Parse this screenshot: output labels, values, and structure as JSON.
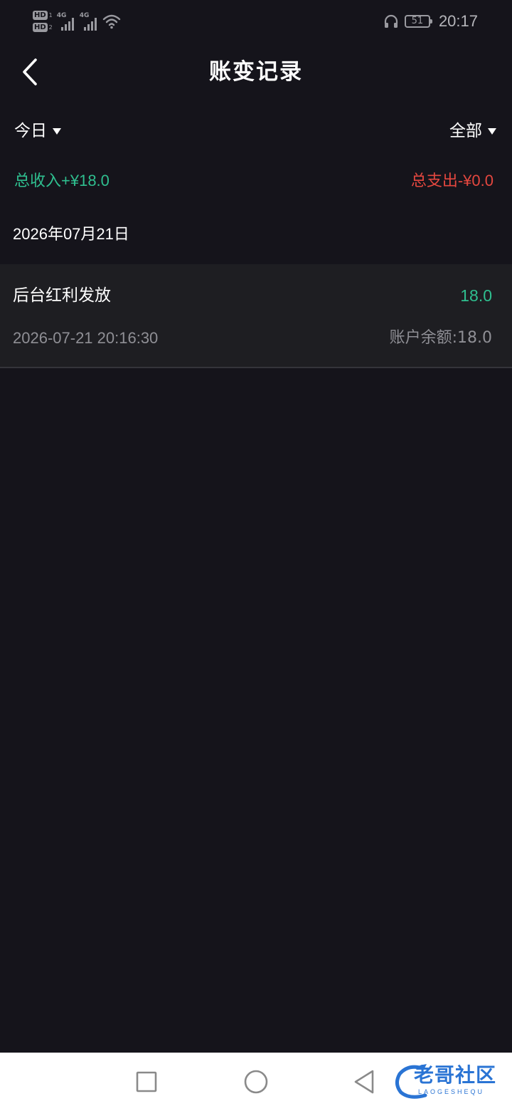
{
  "status_bar": {
    "sim1_hd": "HD",
    "sim1_index": "1",
    "sim2_hd": "HD",
    "sim2_index": "2",
    "network_1": "4G",
    "network_2": "4G",
    "battery_level": "51",
    "time": "20:17",
    "icons": [
      "signal-icon",
      "wifi-icon",
      "headphones-icon",
      "battery-icon"
    ]
  },
  "header": {
    "title": "账变记录",
    "back_icon": "chevron-left-icon"
  },
  "filters": {
    "date_range": "今日",
    "type": "全部"
  },
  "summary": {
    "income": "总收入+¥18.0",
    "expense": "总支出-¥0.0",
    "income_color": "#2fbf8f",
    "expense_color": "#e4473f"
  },
  "groups": [
    {
      "date": "2026年07月21日",
      "records": [
        {
          "title": "后台红利发放",
          "amount": "18.0",
          "time": "2026-07-21 20:16:30",
          "balance": "账户余额:18.0"
        }
      ]
    }
  ],
  "nav_bar": {
    "icons": [
      "recent-apps-icon",
      "home-icon",
      "back-triangle-icon"
    ]
  },
  "watermark": {
    "main": "老哥社区",
    "sub": "LAOGESHEQU"
  }
}
